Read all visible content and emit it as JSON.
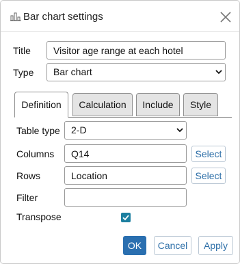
{
  "dialog": {
    "title": "Bar chart settings",
    "title_icon": "bar-chart-icon",
    "close_icon": "close-icon"
  },
  "form": {
    "title_label": "Title",
    "title_value": "Visitor age range at each hotel",
    "type_label": "Type",
    "type_value": "Bar chart"
  },
  "tabs": [
    {
      "label": "Definition",
      "active": true
    },
    {
      "label": "Calculation",
      "active": false
    },
    {
      "label": "Include",
      "active": false
    },
    {
      "label": "Style",
      "active": false
    }
  ],
  "definition": {
    "table_type_label": "Table type",
    "table_type_value": "2-D",
    "columns_label": "Columns",
    "columns_value": "Q14",
    "columns_select": "Select",
    "rows_label": "Rows",
    "rows_value": "Location",
    "rows_select": "Select",
    "filter_label": "Filter",
    "filter_value": "",
    "transpose_label": "Transpose",
    "transpose_checked": true
  },
  "footer": {
    "ok": "OK",
    "cancel": "Cancel",
    "apply": "Apply"
  },
  "colors": {
    "accent": "#2a6fb0",
    "link": "#2d6fa8",
    "checkbox": "#1c7fa0"
  }
}
